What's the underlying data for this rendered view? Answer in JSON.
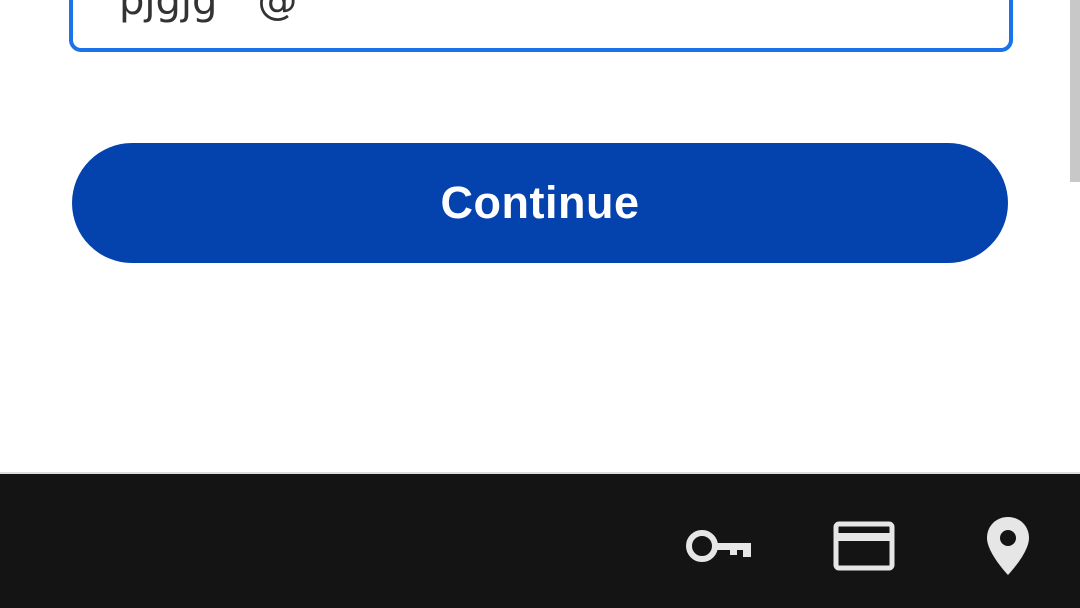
{
  "form": {
    "field_value": "pjgjg     @",
    "continue_label": "Continue"
  },
  "accessory_bar": {
    "icons": [
      "key-icon",
      "credit-card-icon",
      "location-pin-icon"
    ]
  },
  "colors": {
    "accent": "#1a73e8",
    "button": "#0443ae",
    "bar_background": "#141414",
    "icon": "#e6e6e6"
  }
}
